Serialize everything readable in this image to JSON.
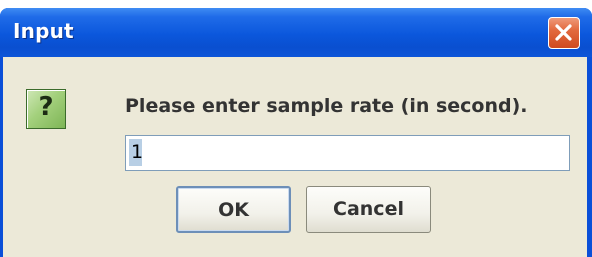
{
  "window": {
    "title": "Input",
    "close_icon": "close-icon"
  },
  "dialog": {
    "icon": "question-icon",
    "icon_glyph": "?",
    "message": "Please enter sample rate (in second).",
    "input_value": "1"
  },
  "buttons": {
    "ok_label": "OK",
    "cancel_label": "Cancel"
  },
  "colors": {
    "titlebar": "#0b57dc",
    "client_background": "#ece9d8",
    "close_button": "#e36a3f",
    "question_icon": "#a3d07c"
  }
}
